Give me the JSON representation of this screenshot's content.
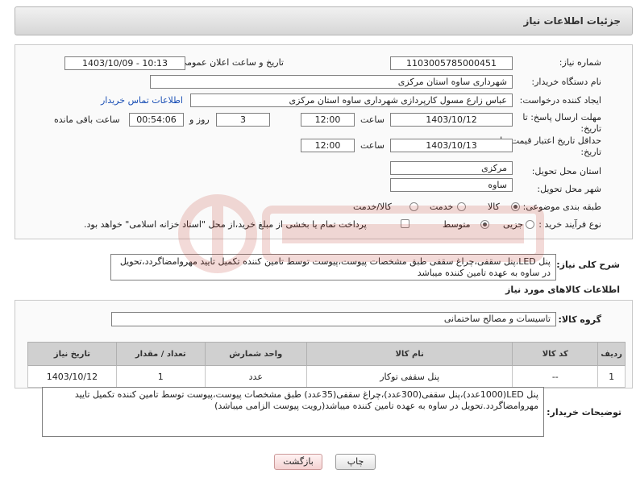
{
  "header": {
    "title": "جزئیات اطلاعات نیاز"
  },
  "form": {
    "need_number_label": "شماره نیاز:",
    "need_number": "1103005785000451",
    "announce_label": "تاریخ و ساعت اعلان عمومی:",
    "announce_value": "1403/10/09 - 10:13",
    "buyer_label": "نام دستگاه خریدار:",
    "buyer_value": "شهرداری ساوه استان مرکزی",
    "creator_label": "ایجاد کننده درخواست:",
    "creator_value": "عباس زارع مسول کارپردازی شهرداری ساوه استان مرکزی",
    "contact_link": "اطلاعات تماس خریدار",
    "deadline_label": "مهلت ارسال پاسخ: تا تاریخ:",
    "deadline_date": "1403/10/12",
    "deadline_time_label": "ساعت",
    "deadline_time": "12:00",
    "days_value": "3",
    "days_label": "روز و",
    "remaining_value": "00:54:06",
    "remaining_label": "ساعت باقی مانده",
    "validity_label": "حداقل تاریخ اعتبار قیمت: تا تاریخ:",
    "validity_date": "1403/10/13",
    "validity_time_label": "ساعت",
    "validity_time": "12:00",
    "province_label": "استان محل تحویل:",
    "province_value": "مرکزی",
    "city_label": "شهر محل تحویل:",
    "city_value": "ساوه",
    "category_label": "طبقه بندی موضوعی:",
    "category_options": [
      "کالا",
      "خدمت",
      "کالا/خدمت"
    ],
    "process_label": "نوع فرآیند خرید :",
    "process_options": [
      "جزیی",
      "متوسط"
    ],
    "process_note": "پرداخت تمام یا بخشی از مبلغ خرید،از محل \"اسناد خزانه اسلامی\" خواهد بود."
  },
  "description": {
    "label": "شرح کلی نیاز:",
    "text": "پنل LED،پنل سقفی،چراغ سقفی طبق مشخصات پیوست،پیوست توسط تامین کننده تکمیل تایید مهروامضاگردد،تحویل در ساوه به عهده تامین کننده میباشد"
  },
  "goods": {
    "section_title": "اطلاعات کالاهای مورد نیاز",
    "group_label": "گروه کالا:",
    "group_value": "تاسیسات و مصالح ساختمانی",
    "columns": [
      "ردیف",
      "کد کالا",
      "نام کالا",
      "واحد شمارش",
      "تعداد / مقدار",
      "تاریخ نیاز"
    ],
    "rows": [
      {
        "index": "1",
        "code": "--",
        "name": "پنل سقفی توکار",
        "unit": "عدد",
        "qty": "1",
        "date": "1403/10/12"
      }
    ]
  },
  "buyer_notes": {
    "label": "توضیحات خریدار:",
    "text": "پنل LED(1000عدد)،پنل سقفی(300عدد)،چراغ سقفی(35عدد) طبق مشخصات پیوست،پیوست توسط تامین کننده تکمیل تایید مهروامضاگردد.تحویل در ساوه به عهده تامین کننده میباشد(رویت پیوست الزامی میباشد)"
  },
  "buttons": {
    "print": "چاپ",
    "back": "بازگشت"
  },
  "colors": {
    "link": "#1a4fb5",
    "watermark": "#c0392b"
  }
}
